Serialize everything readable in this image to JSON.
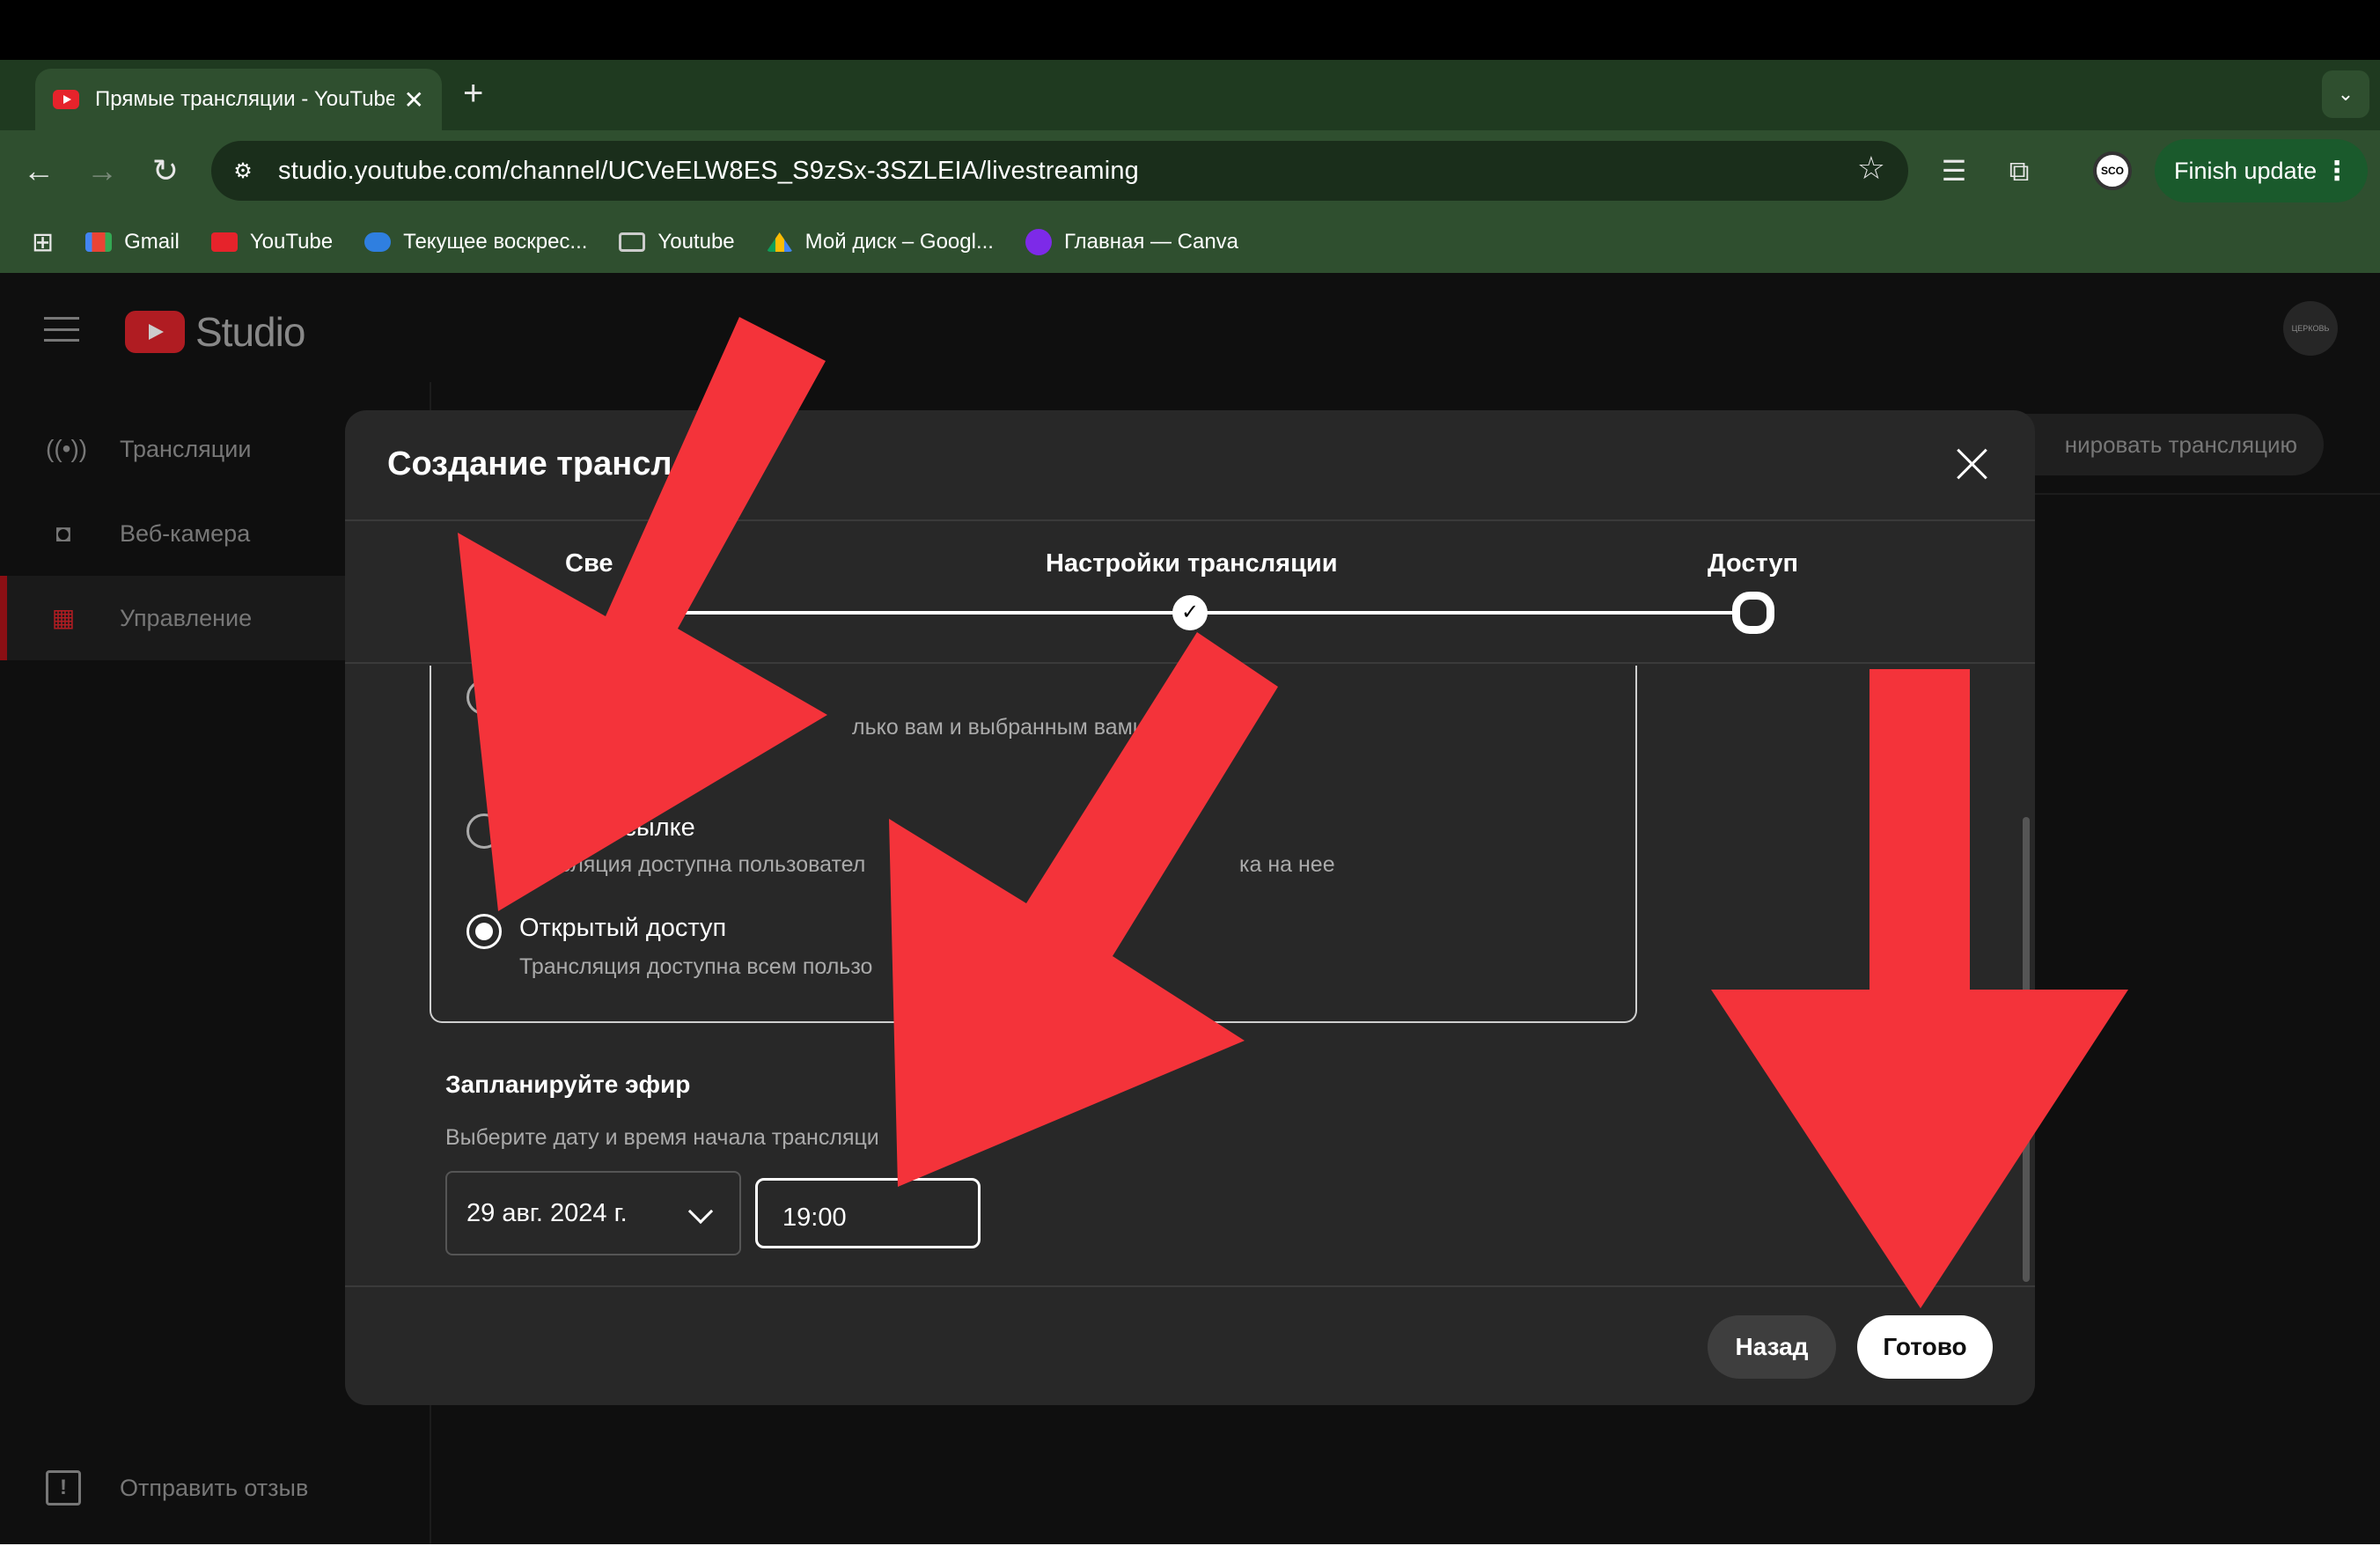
{
  "browser": {
    "tab_title": "Прямые трансляции - YouTube",
    "url": "studio.youtube.com/channel/UCVeELW8ES_S9zSx-3SZLEIA/livestreaming",
    "finish_update": "Finish update",
    "bookmarks": [
      {
        "label": "Gmail",
        "icon": "gmail-icon",
        "color": "#ea4335"
      },
      {
        "label": "YouTube",
        "icon": "youtube-icon",
        "color": "#e6232b"
      },
      {
        "label": "Текущее воскрес...",
        "icon": "onedrive-icon",
        "color": "#2f7fe0"
      },
      {
        "label": "Youtube",
        "icon": "folder-icon",
        "color": "#cccccc"
      },
      {
        "label": "Мой диск – Googl...",
        "icon": "google-drive-icon",
        "color": "#fbbc04"
      },
      {
        "label": "Главная — Canva",
        "icon": "canva-icon",
        "color": "#7d2ae8"
      }
    ]
  },
  "studio": {
    "logo_text": "Studio",
    "avatar_text": "ЦЕРКОВЬ",
    "schedule_button": "нировать трансляцию",
    "sidebar": [
      {
        "label": "Трансляции",
        "icon": "broadcast-icon"
      },
      {
        "label": "Веб-камера",
        "icon": "camera-icon"
      },
      {
        "label": "Управление",
        "icon": "calendar-icon",
        "active": true
      }
    ],
    "feedback": "Отправить отзыв"
  },
  "modal": {
    "title": "Создание трансл",
    "steps": [
      {
        "label": "Све",
        "state": "done"
      },
      {
        "label": "Настройки трансляции",
        "state": "done"
      },
      {
        "label": "Доступ",
        "state": "current"
      }
    ],
    "visibility_options": [
      {
        "title": "л",
        "desc": "лько вам и выбранным вами",
        "checked": false
      },
      {
        "title": "по ссылке",
        "desc": "ансляция доступна пользовател",
        "desc_tail": "торых",
        "desc_end": "ка на нее",
        "checked": false
      },
      {
        "title": "Открытый доступ",
        "desc": "Трансляция доступна всем пользо",
        "checked": true
      }
    ],
    "schedule_title": "Запланируйте эфир",
    "schedule_desc": "Выберите дату и время начала трансляци",
    "date_value": "29 авг. 2024 г.",
    "time_value": "19:00",
    "back_label": "Назад",
    "done_label": "Готово"
  },
  "colors": {
    "annotation_arrow": "#f4333a",
    "tab_strip": "#1f3a20",
    "toolbar": "#2f4f2f",
    "youtube_red": "#e6232b"
  }
}
